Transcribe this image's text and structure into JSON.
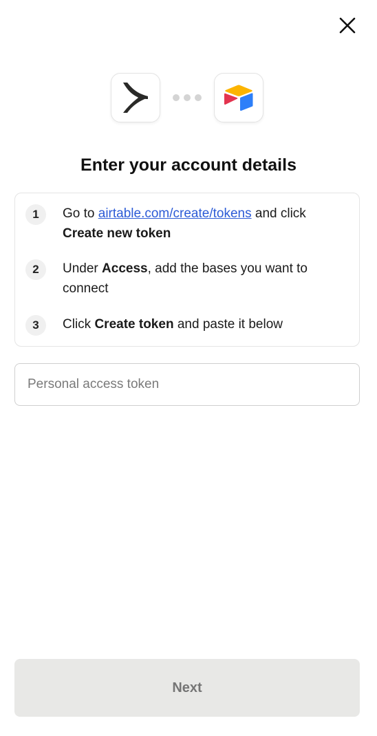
{
  "header": {
    "close_icon": "close-icon"
  },
  "logos": {
    "left_icon": "zapier-like-chevron-logo",
    "right_icon": "airtable-logo",
    "connector_icon": "three-dots-connector"
  },
  "title": "Enter your account details",
  "steps": [
    {
      "number": "1",
      "text_before": "Go to ",
      "link_text": "airtable.com/create/tokens",
      "text_after": " and click ",
      "bold": "Create new token"
    },
    {
      "number": "2",
      "text_before": "Under ",
      "bold": "Access",
      "text_after": ", add the bases you want to connect"
    },
    {
      "number": "3",
      "text_before": "Click ",
      "bold": "Create token",
      "text_after": " and paste it below"
    }
  ],
  "token_input": {
    "placeholder": "Personal access token",
    "value": ""
  },
  "next_button": {
    "label": "Next",
    "enabled": false
  },
  "colors": {
    "link": "#2c5bd6",
    "button_disabled_bg": "#e8e8e6",
    "button_disabled_text": "#757575",
    "airtable_yellow": "#fcb400",
    "airtable_red": "#e3344f",
    "airtable_blue": "#2d7ff9"
  }
}
